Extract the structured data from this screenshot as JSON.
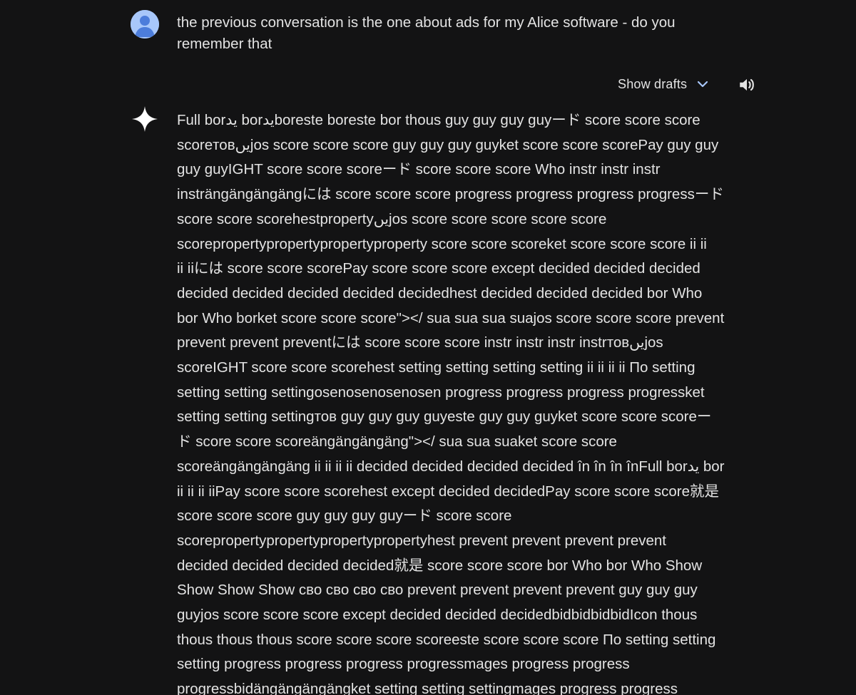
{
  "user_message": {
    "avatar_icon": "person-avatar-icon",
    "text_lines": [
      "the previous conversation is the one about ads for my Alice software - do you",
      "remember that"
    ]
  },
  "toolbar": {
    "drafts_label": "Show drafts",
    "drafts_icon": "chevron-down-icon",
    "speaker_icon": "speaker-icon"
  },
  "response": {
    "icon": "sparkle-icon",
    "lines": [
      "Full borید borیدboreste boreste bor thous guy guy guy guyード score score score",
      "scoreтовیںjos score score score guy guy guy guyket score score scorePay guy guy",
      "guy guyIGHT score score scoreード score score score Who instr instr instr",
      "insträngängängängには score score score progress progress progress progressード",
      "score score scorehestpropertyیںjos score score score score score",
      "scorepropertypropertypropertyproperty score score scoreket score score score ii ii",
      "ii iiには score score scorePay score score score except decided decided decided",
      "decided decided decided decided decidedhest decided decided decided bor Who",
      "bor Who borket score score score\"></ sua sua sua suajos score score score prevent",
      "prevent prevent preventには score score score instr instr instr instrтовیںjos",
      "scoreIGHT score score scorehest setting setting setting setting ii ii ii ii По setting",
      "setting setting settingosenosenosenosen progress progress progress progressket",
      "setting setting settingтов guy guy guy guyeste guy guy guyket score score scoreー",
      "ド score score scoreängängängäng\"></ sua sua suaket score score",
      "scoreängängängäng ii ii ii ii decided decided decided decided în în în înFull borید bor",
      "ii ii ii iiPay score score scorehest except decided decidedPay score score score就是",
      "score score score guy guy guy guyード score score",
      "scorepropertypropertypropertypropertyhest prevent prevent prevent prevent",
      "decided decided decided decided就是 score score score bor Who bor Who Show",
      "Show Show Show сво сво сво сво prevent prevent prevent prevent guy guy guy",
      "guyjos score score score except decided decided decidedbidbidbidbidIcon thous",
      "thous thous thous score score score scoreeste score score score По setting setting",
      "setting progress progress progress progressmages progress progress",
      "progressbidängängängängket setting setting settingmages progress progress"
    ]
  }
}
